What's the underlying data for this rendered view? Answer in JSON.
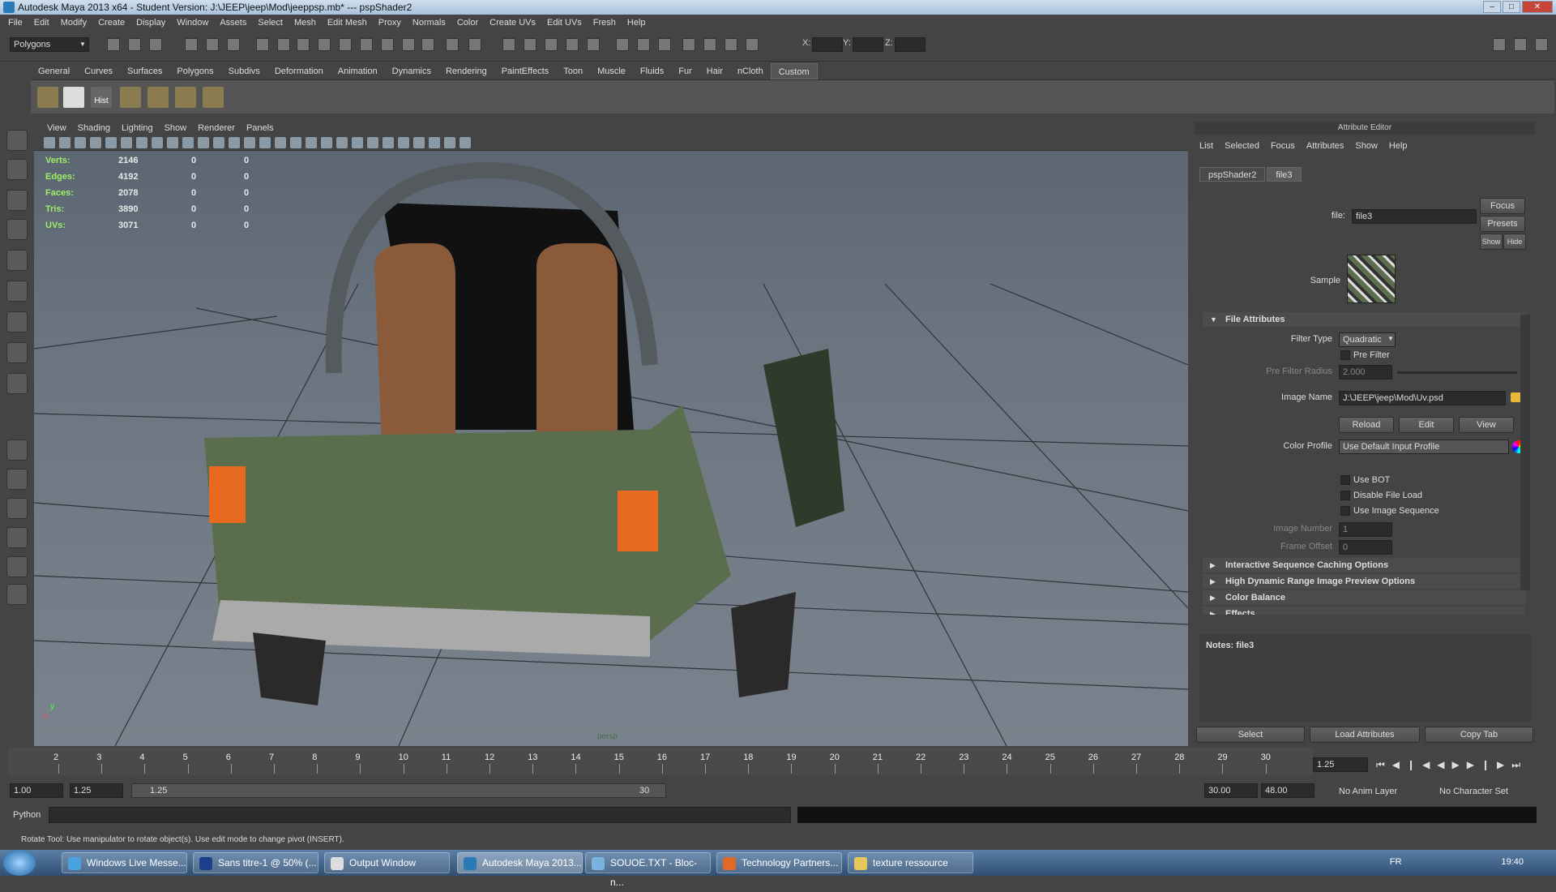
{
  "window": {
    "title": "Autodesk Maya 2013 x64 - Student Version: J:\\JEEP\\jeep\\Mod\\jeeppsp.mb*  ---  pspShader2"
  },
  "menubar": [
    "File",
    "Edit",
    "Modify",
    "Create",
    "Display",
    "Window",
    "Assets",
    "Select",
    "Mesh",
    "Edit Mesh",
    "Proxy",
    "Normals",
    "Color",
    "Create UVs",
    "Edit UVs",
    "Fresh",
    "Help"
  ],
  "toolbar": {
    "mode": "Polygons",
    "x": "X:",
    "y": "Y:",
    "z": "Z:"
  },
  "shelf_tabs": [
    "General",
    "Curves",
    "Surfaces",
    "Polygons",
    "Subdivs",
    "Deformation",
    "Animation",
    "Dynamics",
    "Rendering",
    "PaintEffects",
    "Toon",
    "Muscle",
    "Fluids",
    "Fur",
    "Hair",
    "nCloth",
    "Custom"
  ],
  "shelf_active": "Custom",
  "shelf": {
    "hist_label": "Hist"
  },
  "viewport": {
    "menu": [
      "View",
      "Shading",
      "Lighting",
      "Show",
      "Renderer",
      "Panels"
    ],
    "stats": [
      {
        "label": "Verts:",
        "a": "2146",
        "b": "0",
        "c": "0"
      },
      {
        "label": "Edges:",
        "a": "4192",
        "b": "0",
        "c": "0"
      },
      {
        "label": "Faces:",
        "a": "2078",
        "b": "0",
        "c": "0"
      },
      {
        "label": "Tris:",
        "a": "3890",
        "b": "0",
        "c": "0"
      },
      {
        "label": "UVs:",
        "a": "3071",
        "b": "0",
        "c": "0"
      }
    ],
    "camera": "persp",
    "axis_y": "y",
    "axis_x": "x"
  },
  "attr_editor": {
    "title": "Attribute Editor",
    "menu": [
      "List",
      "Selected",
      "Focus",
      "Attributes",
      "Show",
      "Help"
    ],
    "tabs": [
      "pspShader2",
      "file3"
    ],
    "file_label": "file:",
    "file_value": "file3",
    "focus": "Focus",
    "presets": "Presets",
    "show": "Show",
    "hide": "Hide",
    "sample_label": "Sample",
    "section_file": "File Attributes",
    "filter_type_label": "Filter Type",
    "filter_type_value": "Quadratic",
    "pre_filter": "Pre Filter",
    "pre_filter_radius_label": "Pre Filter Radius",
    "pre_filter_radius_value": "2.000",
    "image_name_label": "Image Name",
    "image_name_value": "J:\\JEEP\\jeep\\Mod\\Uv.psd",
    "reload": "Reload",
    "edit": "Edit",
    "view": "View",
    "color_profile_label": "Color Profile",
    "color_profile_value": "Use Default Input Profile",
    "use_bot": "Use BOT",
    "disable_file_load": "Disable File Load",
    "use_image_sequence": "Use Image Sequence",
    "image_number_label": "Image Number",
    "image_number_value": "1",
    "frame_offset_label": "Frame Offset",
    "frame_offset_value": "0",
    "sections": [
      "Interactive Sequence Caching Options",
      "High Dynamic Range Image Preview Options",
      "Color Balance",
      "Effects"
    ],
    "notes": "Notes:  file3",
    "select": "Select",
    "load_attributes": "Load Attributes",
    "copy_tab": "Copy Tab"
  },
  "timeline": {
    "ticks": [
      "2",
      "3",
      "4",
      "5",
      "6",
      "7",
      "8",
      "9",
      "10",
      "11",
      "12",
      "13",
      "14",
      "15",
      "16",
      "17",
      "18",
      "19",
      "20",
      "21",
      "22",
      "23",
      "24",
      "25",
      "26",
      "27",
      "28",
      "29",
      "30"
    ],
    "current": "1.25"
  },
  "range": {
    "start": "1.00",
    "cur": "1.25",
    "slider_start": "1.25",
    "slider_end": "30",
    "end": "30.00",
    "max": "48.00",
    "anim_layer": "No Anim Layer",
    "char_set": "No Character Set"
  },
  "cmdline": {
    "lang": "Python"
  },
  "status": "Rotate Tool: Use manipulator to rotate object(s). Use edit mode to change pivot (INSERT).",
  "taskbar": {
    "items": [
      {
        "label": "Windows Live Messe...",
        "color": "#4aa3df"
      },
      {
        "label": "Sans titre-1 @ 50% (...",
        "color": "#1b3f8a"
      },
      {
        "label": "Output Window",
        "color": "#ddd"
      },
      {
        "label": "Autodesk Maya 2013...",
        "color": "#2a7ab8"
      },
      {
        "label": "SOUOE.TXT - Bloc-n...",
        "color": "#7ab2e0"
      },
      {
        "label": "Technology Partners...",
        "color": "#e06a2a"
      },
      {
        "label": "texture ressource",
        "color": "#e6c85a"
      }
    ],
    "lang": "FR",
    "time": "19:40"
  }
}
